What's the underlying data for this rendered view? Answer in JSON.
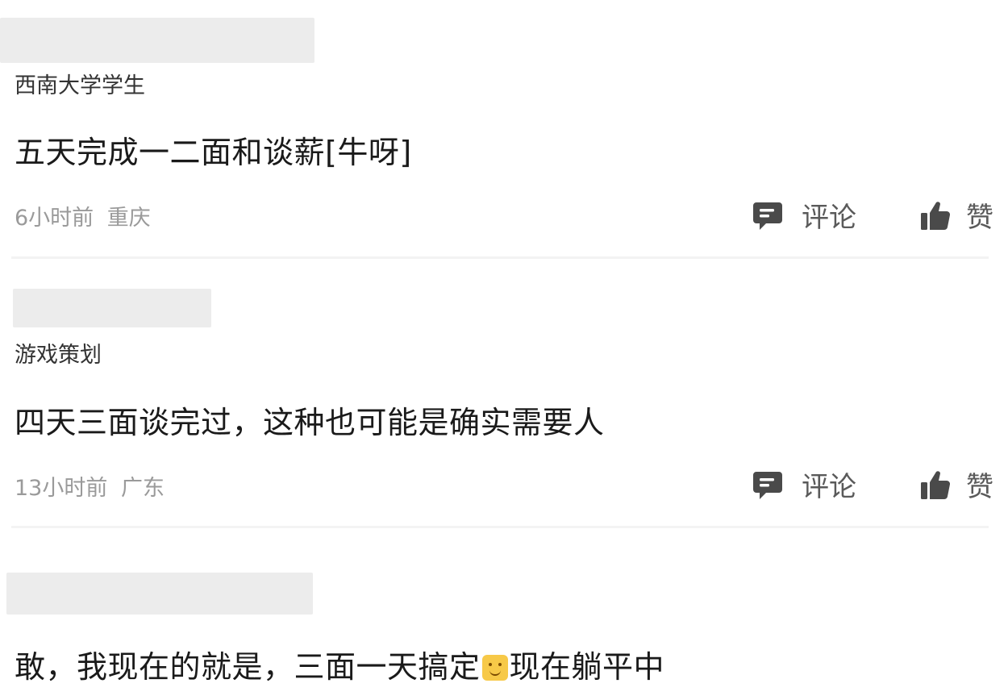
{
  "comments": [
    {
      "tag": "西南大学学生",
      "text": "五天完成一二面和谈薪[牛呀]",
      "time": "6小时前",
      "location": "重庆",
      "comment_label": "评论",
      "like_label": "赞"
    },
    {
      "tag": "游戏策划",
      "text": "四天三面谈完过，这种也可能是确实需要人",
      "time": "13小时前",
      "location": "广东",
      "comment_label": "评论",
      "like_label": "赞"
    },
    {
      "text_before_emoji": "敢，我现在的就是，三面一天搞定",
      "emoji": "smile-emoji",
      "text_after_emoji": "现在躺平中"
    }
  ],
  "icons": {
    "comment": "comment-bubble-icon",
    "like": "thumbs-up-icon"
  },
  "colors": {
    "text": "#1a1a1a",
    "meta": "#9a9a9a",
    "icon": "#4a4a4a",
    "redaction": "#ececec"
  }
}
